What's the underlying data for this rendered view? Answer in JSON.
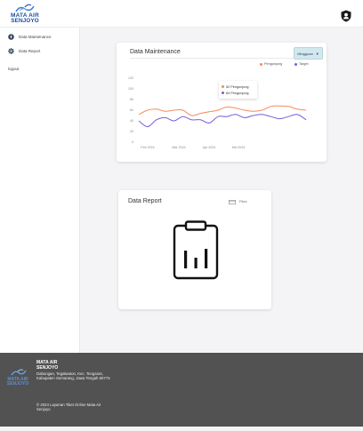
{
  "header": {
    "logo_line1": "MATA AIR",
    "logo_line2": "SENJOYO"
  },
  "sidebar": {
    "items": [
      {
        "label": "Data Maintenance",
        "icon": "water-drop-icon"
      },
      {
        "label": "Data Report",
        "icon": "gear-icon"
      }
    ],
    "logout_label": "logout"
  },
  "maintenance_card": {
    "title": "Data Maintenance",
    "period_label": "Mingguan",
    "legend": [
      {
        "label": "Pengunjung",
        "color": "#f28b5b"
      },
      {
        "label": "Target",
        "color": "#7b5cd6"
      }
    ],
    "tooltip": {
      "rows": [
        {
          "text": "52 Pengunjung",
          "color": "#f28b5b"
        },
        {
          "text": "84 Pengunjung",
          "color": "#7b5cd6"
        }
      ]
    }
  },
  "chart_data": {
    "type": "line",
    "title": "Data Maintenance",
    "x_tick_labels": [
      "Feb 2024",
      "Mar 2024",
      "Apr 2024",
      "Mei 2024"
    ],
    "y_tick_labels": [
      "0",
      "20",
      "40",
      "60",
      "80",
      "100",
      "120"
    ],
    "ylim": [
      0,
      120
    ],
    "legend_position": "top-right",
    "grid": false,
    "series": [
      {
        "name": "Pengunjung",
        "color": "#f28b5b",
        "values": [
          52,
          60,
          62,
          58,
          60,
          60,
          50,
          54,
          57,
          60,
          66,
          64,
          60,
          58,
          60,
          67,
          68,
          67,
          62,
          60
        ]
      },
      {
        "name": "Target",
        "color": "#7b5cd6",
        "values": [
          40,
          29,
          42,
          46,
          40,
          48,
          42,
          42,
          36,
          48,
          48,
          52,
          46,
          50,
          52,
          48,
          44,
          48,
          52,
          42
        ]
      }
    ]
  },
  "report_card": {
    "title": "Data Report",
    "file_label": "Files"
  },
  "footer": {
    "logo_text_line1": "MATA AIR",
    "logo_text_line2": "SENJOYO",
    "name_line1": "MATA AIR",
    "name_line2": "SENJOYO",
    "address": "Dabungan, Tegalwaton, Kec. Tengaran, Kabupaten Semarang, Jawa Tengah 50775",
    "copyright": "© 2024 Layanan Tiket Online Mata Air Senjoyo"
  }
}
